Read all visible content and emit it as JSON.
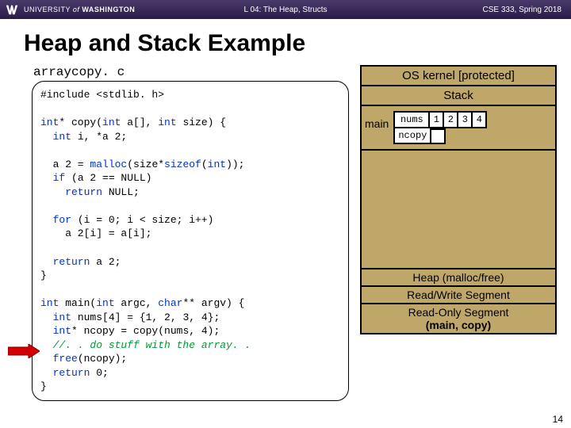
{
  "header": {
    "university_prefix": "UNIVERSITY",
    "university_of": "of",
    "university_name": "WASHINGTON",
    "lecture": "L 04: The Heap, Structs",
    "course": "CSE 333, Spring 2018"
  },
  "title": "Heap and Stack Example",
  "filename": "arraycopy. c",
  "code": {
    "l01": "#include <stdlib. h>",
    "l02": "",
    "l03a": "int",
    "l03b": "* copy(",
    "l03c": "int",
    "l03d": " a[], ",
    "l03e": "int",
    "l03f": " size) {",
    "l04a": "  int",
    "l04b": " i, *a 2;",
    "l05": "",
    "l06a": "  a 2 = ",
    "l06b": "malloc",
    "l06c": "(size*",
    "l06d": "sizeof",
    "l06e": "(",
    "l06f": "int",
    "l06g": "));",
    "l07a": "  if",
    "l07b": " (a 2 == NULL)",
    "l08a": "    return",
    "l08b": " NULL;",
    "l09": "",
    "l10a": "  for",
    "l10b": " (i = 0; i < size; i++)",
    "l11": "    a 2[i] = a[i];",
    "l12": "",
    "l13a": "  return",
    "l13b": " a 2;",
    "l14": "}",
    "l15": "",
    "l16a": "int",
    "l16b": " main(",
    "l16c": "int",
    "l16d": " argc, ",
    "l16e": "char",
    "l16f": "** argv) {",
    "l17a": "  int",
    "l17b": " nums[4] = {1, 2, 3, 4};",
    "l18a": "  int",
    "l18b": "* ncopy = copy(nums, 4);",
    "l19a": "  ",
    "l19b": "//. . do stuff with the array. .",
    "l20a": "  ",
    "l20b": "free",
    "l20c": "(ncopy);",
    "l21a": "  return",
    "l21b": " 0;",
    "l22": "}"
  },
  "mem": {
    "os": "OS kernel [protected]",
    "stack": "Stack",
    "main": "main",
    "nums": "nums",
    "ncopy": "ncopy",
    "cells": [
      "1",
      "2",
      "3",
      "4"
    ],
    "heap": "Heap (malloc/free)",
    "rw": "Read/Write Segment",
    "ro1": "Read-Only Segment",
    "ro2": "(main, copy)"
  },
  "pagenum": "14"
}
